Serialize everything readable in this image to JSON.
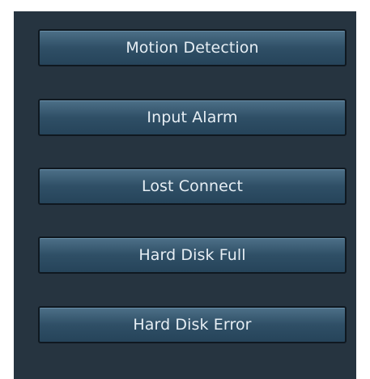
{
  "menu": {
    "items": [
      {
        "label": "Motion Detection"
      },
      {
        "label": "Input Alarm"
      },
      {
        "label": "Lost Connect"
      },
      {
        "label": "Hard Disk Full"
      },
      {
        "label": "Hard Disk Error"
      }
    ]
  }
}
